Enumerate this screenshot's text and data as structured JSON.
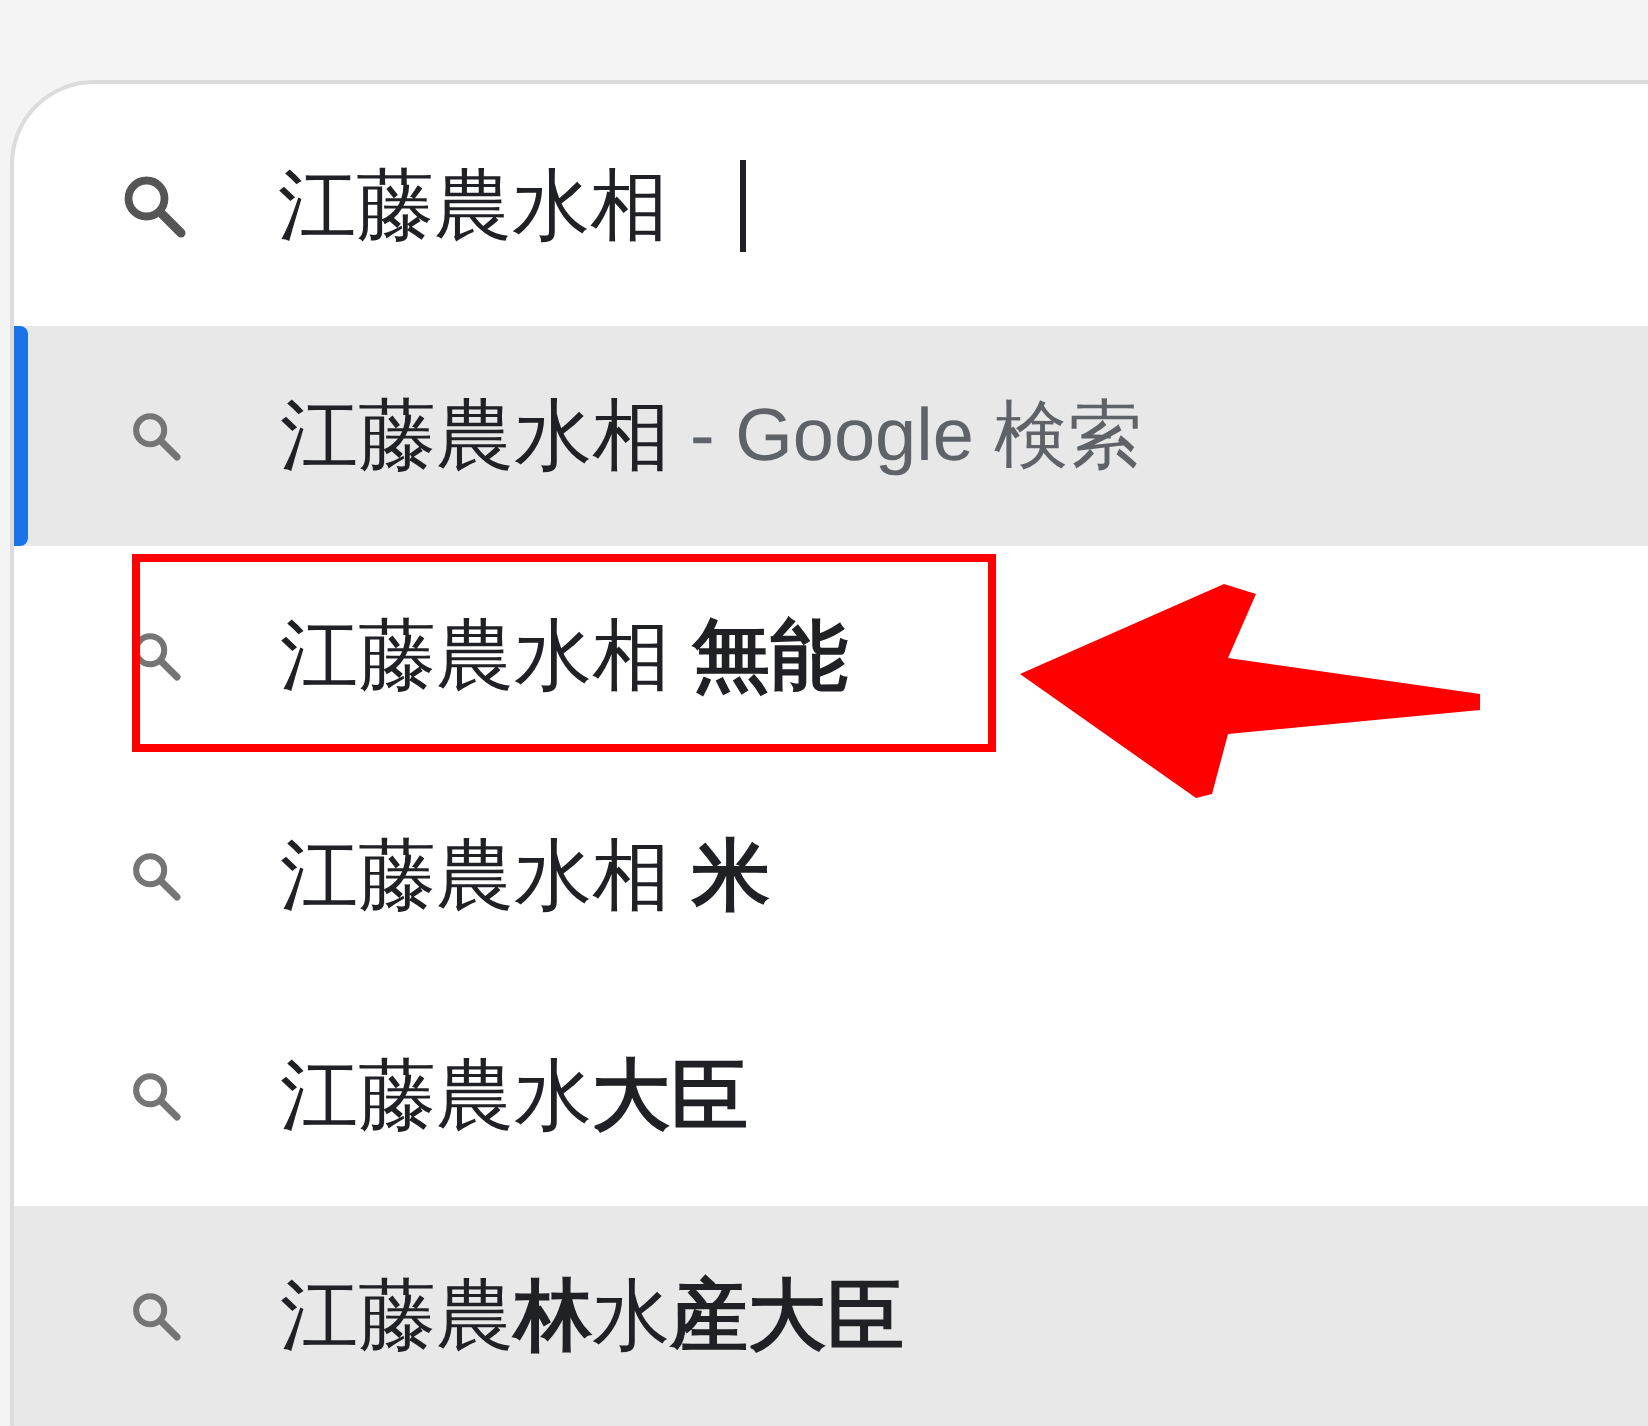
{
  "search": {
    "value": "江藤農水相"
  },
  "suggestions": [
    {
      "text": "江藤農水相",
      "suffix": "- Google 検索",
      "selected": true,
      "hovered": false,
      "annotated": false
    },
    {
      "text": "江藤農水相 **無能**",
      "selected": false,
      "hovered": false,
      "annotated": true
    },
    {
      "text": "江藤農水相 **米**",
      "selected": false,
      "hovered": false,
      "annotated": false
    },
    {
      "text": "江藤農水**大臣**",
      "selected": false,
      "hovered": false,
      "annotated": false
    },
    {
      "text": "江藤農**林**水**産大臣**",
      "selected": false,
      "hovered": true,
      "annotated": false
    }
  ]
}
